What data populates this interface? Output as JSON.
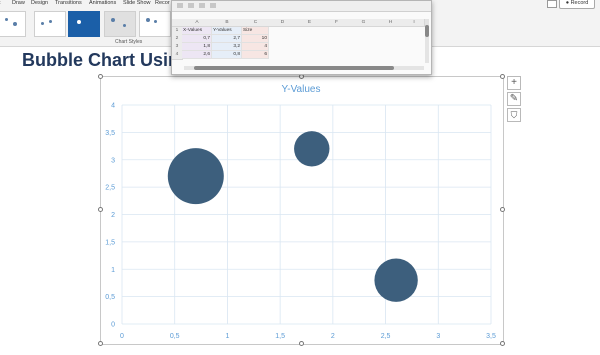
{
  "ribbon": {
    "tabs": [
      "t",
      "Draw",
      "Design",
      "Transitions",
      "Animations",
      "Slide Show",
      "Recor"
    ],
    "record_label": "Record",
    "chart_styles_label": "Chart Styles"
  },
  "slide": {
    "title": "Bubble Chart Using"
  },
  "spreadsheet": {
    "columns": [
      "A",
      "B",
      "C",
      "D",
      "E",
      "F",
      "G",
      "H",
      "I"
    ],
    "rows": [
      {
        "num": "1",
        "cells": [
          "X-Values",
          "Y-Values",
          "Size"
        ]
      },
      {
        "num": "2",
        "cells": [
          "0,7",
          "2,7",
          "10"
        ]
      },
      {
        "num": "3",
        "cells": [
          "1,8",
          "3,2",
          "4"
        ]
      },
      {
        "num": "4",
        "cells": [
          "2,6",
          "0,8",
          "6"
        ]
      }
    ]
  },
  "chart_side_buttons": {
    "elements_icon": "plus-icon",
    "styles_icon": "brush-icon",
    "filter_icon": "filter-icon"
  },
  "chart_data": {
    "type": "scatter",
    "bubble": true,
    "title": "Y-Values",
    "series": [
      {
        "name": "Y-Values",
        "x": [
          0.7,
          1.8,
          2.6
        ],
        "y": [
          2.7,
          3.2,
          0.8
        ],
        "size": [
          10,
          4,
          6
        ],
        "color": "#3d5f7d"
      }
    ],
    "xlim": [
      0,
      3.5
    ],
    "ylim": [
      0,
      4
    ],
    "xticks": [
      "0",
      "0,5",
      "1",
      "1,5",
      "2",
      "2,5",
      "3",
      "3,5"
    ],
    "yticks": [
      "0",
      "0,5",
      "1",
      "1,5",
      "2",
      "2,5",
      "3",
      "3,5",
      "4"
    ],
    "grid": true,
    "legend": "none",
    "text_color": "#5b9bd5"
  }
}
